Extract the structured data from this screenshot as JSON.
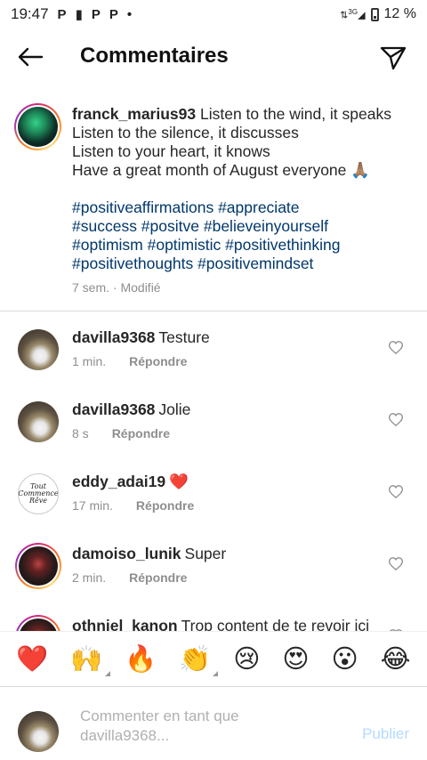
{
  "status_bar": {
    "time": "19:47",
    "notif_icons": [
      "P",
      "P",
      "P"
    ],
    "dot": "•",
    "network": "3G",
    "battery_percent": "12 %"
  },
  "header": {
    "title": "Commentaires"
  },
  "caption": {
    "username": "franck_marius93",
    "lines": [
      "Listen to the wind, it speaks",
      "Listen to the silence, it discusses",
      "Listen to your heart, it knows",
      "Have a great month of August everyone 🙏🏽"
    ],
    "hashtag_lines": [
      "#positiveaffirmations #appreciate",
      "#success #positve #believeinyourself",
      "#optimism #optimistic #positivethinking",
      "#positivethoughts #positivemindset"
    ],
    "meta": "7 sem. · Modifié"
  },
  "comments": [
    {
      "username": "davilla9368",
      "text": "Testure",
      "time": "1 min.",
      "reply": "Répondre"
    },
    {
      "username": "davilla9368",
      "text": "Jolie",
      "time": "8 s",
      "reply": "Répondre"
    },
    {
      "username": "eddy_adai19",
      "text": "❤️",
      "time": "17 min.",
      "reply": "Répondre",
      "avatar_text": "Tout Commence Rêve"
    },
    {
      "username": "damoiso_lunik",
      "text": "Super",
      "time": "2 min.",
      "reply": "Répondre"
    },
    {
      "username": "othniel_kanon",
      "text": "Trop content de te revoir ici",
      "time": "",
      "reply": ""
    }
  ],
  "emoji_bar": [
    "❤️",
    "🙌",
    "🔥",
    "👏",
    "😢",
    "😍",
    "😮",
    "😂"
  ],
  "composer": {
    "placeholder": "Commenter en tant que davilla9368...",
    "publish_label": "Publier"
  },
  "colors": {
    "link": "#00376b",
    "meta": "#8e8e8e",
    "publish_disabled": "#b3dbff"
  }
}
